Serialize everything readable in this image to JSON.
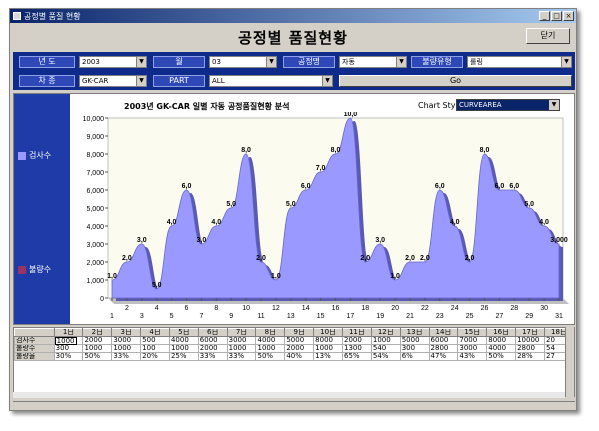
{
  "window": {
    "title": "공정별 품질 현황"
  },
  "header": {
    "title": "공정별 품질현황",
    "close_label": "닫기"
  },
  "filters": {
    "year_label": "년 도",
    "year_value": "2003",
    "month_label": "월",
    "month_value": "03",
    "process_label": "공정명",
    "process_value": "자동",
    "defect_type_label": "불량유형",
    "defect_type_value": "롤링",
    "car_label": "차 종",
    "car_value": "GK-CAR",
    "part_label": "PART",
    "part_value": "ALL",
    "go_label": "Go"
  },
  "legend": {
    "inspect": "검사수",
    "defect": "불량수"
  },
  "chart_style": {
    "label": "Chart Style:",
    "value": "CURVEAREA"
  },
  "chart_data": {
    "type": "area",
    "title": "2003년 GK-CAR 일별 자동 공정품질현황 분석",
    "x": [
      1,
      2,
      3,
      4,
      5,
      6,
      7,
      8,
      9,
      10,
      11,
      12,
      13,
      14,
      15,
      16,
      17,
      18,
      19,
      20,
      21,
      22,
      23,
      24,
      25,
      26,
      27,
      28,
      29,
      30,
      31
    ],
    "x_ticks": [
      "1",
      "2",
      "3",
      "4",
      "5",
      "6",
      "7",
      "8",
      "9",
      "10",
      "11",
      "12",
      "13",
      "14",
      "15",
      "16",
      "17",
      "18",
      "19",
      "20",
      "21",
      "22",
      "23",
      "24",
      "25",
      "26",
      "27",
      "28",
      "29",
      "30",
      "31"
    ],
    "ylim": [
      0,
      10000
    ],
    "y_ticks": [
      "0",
      "1,000",
      "2,000",
      "3,000",
      "4,000",
      "5,000",
      "6,000",
      "7,000",
      "8,000",
      "9,000",
      "10,000"
    ],
    "series": [
      {
        "name": "검사수",
        "color": "#9999ff",
        "values": [
          1000,
          2000,
          3000,
          500,
          4000,
          6000,
          3000,
          4000,
          5000,
          8000,
          2000,
          1000,
          5000,
          6000,
          7000,
          8000,
          10000,
          2000,
          3000,
          1000,
          2000,
          2000,
          6000,
          4000,
          2000,
          8000,
          6000,
          6000,
          5000,
          4000,
          3000
        ]
      },
      {
        "name": "불량수",
        "color": "#993366",
        "values": [
          300,
          1000,
          1000,
          100,
          1000,
          2000,
          1000,
          1000,
          2000,
          1000,
          1300,
          540,
          300,
          2800,
          3000,
          4000,
          2800,
          2000,
          1000,
          1000,
          500,
          500,
          1000,
          1000,
          500,
          2000,
          1000,
          1000,
          1000,
          1000,
          500
        ]
      }
    ],
    "data_labels": [
      "1,0",
      "2,0",
      "3,0",
      "5,0",
      "4,0",
      "6,0",
      "3,0",
      "4,0",
      "5,0",
      "8,0",
      "2,0",
      "1,0",
      "5,0",
      "6,0",
      "7,0",
      "8,0",
      "10,0",
      "2,0",
      "3,0",
      "1,0",
      "2,0",
      "2,0",
      "6,0",
      "4,0",
      "2,0",
      "8,0",
      "6,0",
      "6,0",
      "5,0",
      "4,0",
      "3,000"
    ]
  },
  "grid": {
    "columns": [
      "",
      "1日",
      "2日",
      "3日",
      "4日",
      "5日",
      "6日",
      "7日",
      "8日",
      "9日",
      "10日",
      "11日",
      "12日",
      "13日",
      "14日",
      "15日",
      "16日",
      "17日",
      "18日"
    ],
    "rows": [
      {
        "label": "검사수",
        "cells": [
          "1000",
          "2000",
          "3000",
          "500",
          "4000",
          "6000",
          "3000",
          "4000",
          "5000",
          "8000",
          "2000",
          "1000",
          "5000",
          "6000",
          "7000",
          "8000",
          "10000",
          "20"
        ]
      },
      {
        "label": "불량수",
        "cells": [
          "300",
          "1000",
          "1000",
          "100",
          "1000",
          "2000",
          "1000",
          "1000",
          "2000",
          "1000",
          "1300",
          "540",
          "300",
          "2800",
          "3000",
          "4000",
          "2800",
          "54"
        ]
      },
      {
        "label": "불량율",
        "cells": [
          "30%",
          "50%",
          "33%",
          "20%",
          "25%",
          "33%",
          "33%",
          "50%",
          "40%",
          "13%",
          "65%",
          "54%",
          "6%",
          "47%",
          "43%",
          "50%",
          "28%",
          "27"
        ]
      }
    ]
  }
}
